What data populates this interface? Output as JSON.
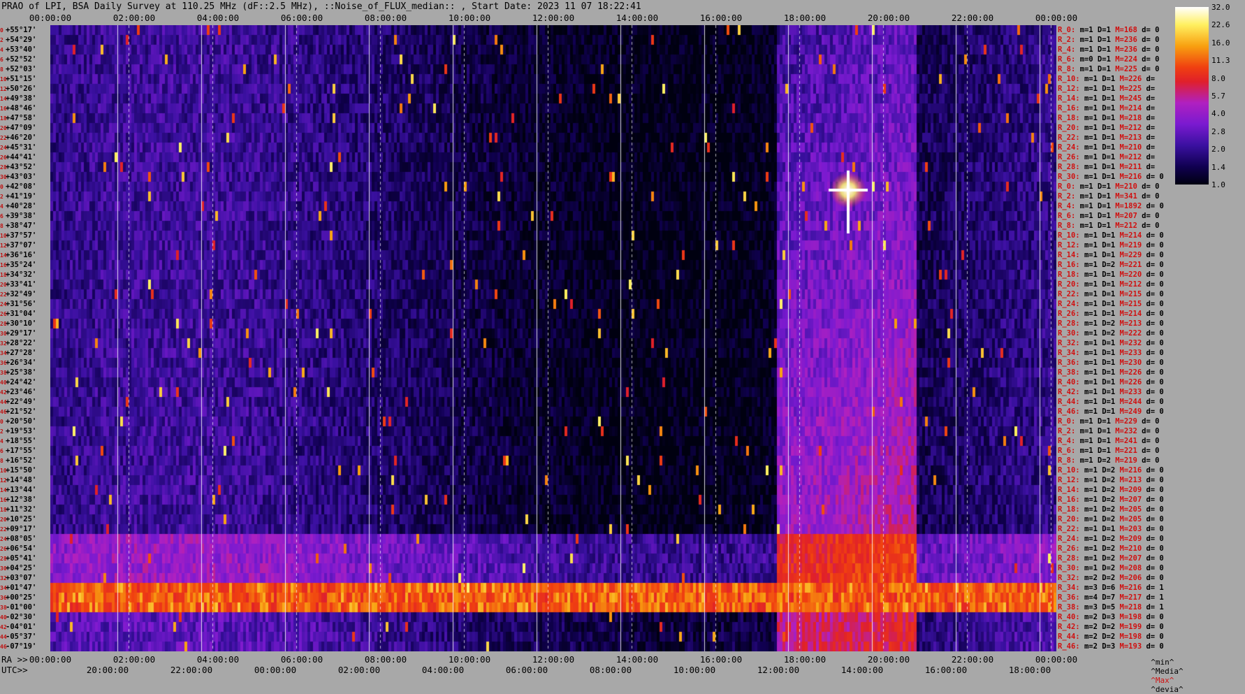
{
  "title": "PRAO of LPI, BSA Daily Survey at 110.25 MHz (dF::2.5 MHz), ::Noise_of_FLUX_median:: , Start Date: 2023 11 07 18:22:41",
  "chart_data": {
    "type": "heatmap",
    "top_axis_ticks": [
      "00:00:00",
      "02:00:00",
      "04:00:00",
      "06:00:00",
      "08:00:00",
      "10:00:00",
      "12:00:00",
      "14:00:00",
      "16:00:00",
      "18:00:00",
      "20:00:00",
      "22:00:00",
      "00:00:00"
    ],
    "bottom_axis_ra_prefix": "RA >>",
    "bottom_axis_ra_ticks": [
      "00:00:00",
      "02:00:00",
      "04:00:00",
      "06:00:00",
      "08:00:00",
      "10:00:00",
      "12:00:00",
      "14:00:00",
      "16:00:00",
      "18:00:00",
      "20:00:00",
      "22:00:00",
      "00:00:00"
    ],
    "bottom_axis_utc_prefix": "UTC>>",
    "bottom_axis_utc_ticks": [
      "20:00:00",
      "22:00:00",
      "00:00:00",
      "02:00:00",
      "04:00:00",
      "06:00:00",
      "08:00:00",
      "10:00:00",
      "12:00:00",
      "14:00:00",
      "16:00:00",
      "18:00:00"
    ],
    "declination_labels": [
      "+55°17'",
      "+54°29'",
      "+53°40'",
      "+52°52'",
      "+52°03'",
      "+51°15'",
      "+50°26'",
      "+49°38'",
      "+48°46'",
      "+47°58'",
      "+47°09'",
      "+46°20'",
      "+45°31'",
      "+44°41'",
      "+43°52'",
      "+43°03'",
      "+42°08'",
      "+41°19'",
      "+40°28'",
      "+39°38'",
      "+38°47'",
      "+37°57'",
      "+37°07'",
      "+36°16'",
      "+35°24'",
      "+34°32'",
      "+33°41'",
      "+32°49'",
      "+31°56'",
      "+31°04'",
      "+30°10'",
      "+29°17'",
      "+28°22'",
      "+27°28'",
      "+26°34'",
      "+25°38'",
      "+24°42'",
      "+23°46'",
      "+22°49'",
      "+21°52'",
      "+20°50'",
      "+19°53'",
      "+18°55'",
      "+17°55'",
      "+16°52'",
      "+15°50'",
      "+14°48'",
      "+13°44'",
      "+12°38'",
      "+11°32'",
      "+10°25'",
      "+09°17'",
      "+08°05'",
      "+06°54'",
      "+05°41'",
      "+04°25'",
      "+03°07'",
      "+01°47'",
      "+00°25'",
      "-01°00'",
      "-02°30'",
      "-04°01'",
      "-05°37'",
      "-07°19'"
    ],
    "declination_row_numbers": [
      "0",
      "2",
      "4",
      "6",
      "8",
      "10",
      "12",
      "14",
      "16",
      "18",
      "20",
      "22",
      "24",
      "26",
      "28",
      "30",
      "0",
      "2",
      "4",
      "6",
      "8",
      "10",
      "12",
      "14",
      "16",
      "18",
      "20",
      "22",
      "24",
      "26",
      "28",
      "30",
      "32",
      "34",
      "36",
      "38",
      "40",
      "42",
      "44",
      "46",
      "0",
      "2",
      "4",
      "6",
      "8",
      "10",
      "12",
      "14",
      "16",
      "18",
      "20",
      "22",
      "24",
      "26",
      "28",
      "30",
      "32",
      "34",
      "36",
      "38",
      "40",
      "42",
      "44",
      "46"
    ],
    "colorbar_ticks": [
      "32.0",
      "22.6",
      "16.0",
      "11.3",
      "8.0",
      "5.7",
      "4.0",
      "2.8",
      "2.0",
      "1.4",
      "1.0"
    ],
    "colorbar_scale": "log",
    "colorbar_range": [
      1.0,
      32.0
    ],
    "colormap": [
      "#000010",
      "#100050",
      "#3a10a0",
      "#7a1ad0",
      "#b020c0",
      "#e0202a",
      "#f04010",
      "#f8a010",
      "#fff060",
      "#ffffff"
    ],
    "receivers": [
      {
        "name": "R_0:",
        "m": "m=1",
        "d": "D=1",
        "max": "M=168",
        "dev": "d= 0"
      },
      {
        "name": "R_2:",
        "m": "m=1",
        "d": "D=1",
        "max": "M=236",
        "dev": "d= 0"
      },
      {
        "name": "R_4:",
        "m": "m=1",
        "d": "D=1",
        "max": "M=236",
        "dev": "d= 0"
      },
      {
        "name": "R_6:",
        "m": "m=0",
        "d": "D=1",
        "max": "M=224",
        "dev": "d= 0"
      },
      {
        "name": "R_8:",
        "m": "m=1",
        "d": "D=1",
        "max": "M=225",
        "dev": "d= 0"
      },
      {
        "name": "R_10:",
        "m": "m=1",
        "d": "D=1",
        "max": "M=226",
        "dev": "d="
      },
      {
        "name": "R_12:",
        "m": "m=1",
        "d": "D=1",
        "max": "M=225",
        "dev": "d="
      },
      {
        "name": "R_14:",
        "m": "m=1",
        "d": "D=1",
        "max": "M=245",
        "dev": "d="
      },
      {
        "name": "R_16:",
        "m": "m=1",
        "d": "D=1",
        "max": "M=214",
        "dev": "d="
      },
      {
        "name": "R_18:",
        "m": "m=1",
        "d": "D=1",
        "max": "M=218",
        "dev": "d="
      },
      {
        "name": "R_20:",
        "m": "m=1",
        "d": "D=1",
        "max": "M=212",
        "dev": "d="
      },
      {
        "name": "R_22:",
        "m": "m=1",
        "d": "D=1",
        "max": "M=213",
        "dev": "d="
      },
      {
        "name": "R_24:",
        "m": "m=1",
        "d": "D=1",
        "max": "M=210",
        "dev": "d="
      },
      {
        "name": "R_26:",
        "m": "m=1",
        "d": "D=1",
        "max": "M=212",
        "dev": "d="
      },
      {
        "name": "R_28:",
        "m": "m=1",
        "d": "D=1",
        "max": "M=211",
        "dev": "d="
      },
      {
        "name": "R_30:",
        "m": "m=1",
        "d": "D=1",
        "max": "M=216",
        "dev": "d= 0"
      },
      {
        "name": "R_0:",
        "m": "m=1",
        "d": "D=1",
        "max": "M=210",
        "dev": "d= 0"
      },
      {
        "name": "R_2:",
        "m": "m=1",
        "d": "D=1",
        "max": "M=341",
        "dev": "d= 0"
      },
      {
        "name": "R_4:",
        "m": "m=1",
        "d": "D=1",
        "max": "M=1892",
        "dev": "d= 0"
      },
      {
        "name": "R_6:",
        "m": "m=1",
        "d": "D=1",
        "max": "M=207",
        "dev": "d= 0"
      },
      {
        "name": "R_8:",
        "m": "m=1",
        "d": "D=1",
        "max": "M=212",
        "dev": "d= 0"
      },
      {
        "name": "R_10:",
        "m": "m=1",
        "d": "D=1",
        "max": "M=214",
        "dev": "d= 0"
      },
      {
        "name": "R_12:",
        "m": "m=1",
        "d": "D=1",
        "max": "M=219",
        "dev": "d= 0"
      },
      {
        "name": "R_14:",
        "m": "m=1",
        "d": "D=1",
        "max": "M=229",
        "dev": "d= 0"
      },
      {
        "name": "R_16:",
        "m": "m=1",
        "d": "D=2",
        "max": "M=221",
        "dev": "d= 0"
      },
      {
        "name": "R_18:",
        "m": "m=1",
        "d": "D=1",
        "max": "M=220",
        "dev": "d= 0"
      },
      {
        "name": "R_20:",
        "m": "m=1",
        "d": "D=1",
        "max": "M=212",
        "dev": "d= 0"
      },
      {
        "name": "R_22:",
        "m": "m=1",
        "d": "D=1",
        "max": "M=215",
        "dev": "d= 0"
      },
      {
        "name": "R_24:",
        "m": "m=1",
        "d": "D=1",
        "max": "M=215",
        "dev": "d= 0"
      },
      {
        "name": "R_26:",
        "m": "m=1",
        "d": "D=1",
        "max": "M=214",
        "dev": "d= 0"
      },
      {
        "name": "R_28:",
        "m": "m=1",
        "d": "D=2",
        "max": "M=213",
        "dev": "d= 0"
      },
      {
        "name": "R_30:",
        "m": "m=1",
        "d": "D=2",
        "max": "M=222",
        "dev": "d= 0"
      },
      {
        "name": "R_32:",
        "m": "m=1",
        "d": "D=1",
        "max": "M=232",
        "dev": "d= 0"
      },
      {
        "name": "R_34:",
        "m": "m=1",
        "d": "D=1",
        "max": "M=233",
        "dev": "d= 0"
      },
      {
        "name": "R_36:",
        "m": "m=1",
        "d": "D=1",
        "max": "M=230",
        "dev": "d= 0"
      },
      {
        "name": "R_38:",
        "m": "m=1",
        "d": "D=1",
        "max": "M=226",
        "dev": "d= 0"
      },
      {
        "name": "R_40:",
        "m": "m=1",
        "d": "D=1",
        "max": "M=226",
        "dev": "d= 0"
      },
      {
        "name": "R_42:",
        "m": "m=1",
        "d": "D=1",
        "max": "M=233",
        "dev": "d= 0"
      },
      {
        "name": "R_44:",
        "m": "m=1",
        "d": "D=1",
        "max": "M=244",
        "dev": "d= 0"
      },
      {
        "name": "R_46:",
        "m": "m=1",
        "d": "D=1",
        "max": "M=249",
        "dev": "d= 0"
      },
      {
        "name": "R_0:",
        "m": "m=1",
        "d": "D=1",
        "max": "M=229",
        "dev": "d= 0"
      },
      {
        "name": "R_2:",
        "m": "m=1",
        "d": "D=1",
        "max": "M=232",
        "dev": "d= 0"
      },
      {
        "name": "R_4:",
        "m": "m=1",
        "d": "D=1",
        "max": "M=241",
        "dev": "d= 0"
      },
      {
        "name": "R_6:",
        "m": "m=1",
        "d": "D=1",
        "max": "M=221",
        "dev": "d= 0"
      },
      {
        "name": "R_8:",
        "m": "m=1",
        "d": "D=2",
        "max": "M=219",
        "dev": "d= 0"
      },
      {
        "name": "R_10:",
        "m": "m=1",
        "d": "D=2",
        "max": "M=216",
        "dev": "d= 0"
      },
      {
        "name": "R_12:",
        "m": "m=1",
        "d": "D=2",
        "max": "M=213",
        "dev": "d= 0"
      },
      {
        "name": "R_14:",
        "m": "m=1",
        "d": "D=2",
        "max": "M=209",
        "dev": "d= 0"
      },
      {
        "name": "R_16:",
        "m": "m=1",
        "d": "D=2",
        "max": "M=207",
        "dev": "d= 0"
      },
      {
        "name": "R_18:",
        "m": "m=1",
        "d": "D=2",
        "max": "M=205",
        "dev": "d= 0"
      },
      {
        "name": "R_20:",
        "m": "m=1",
        "d": "D=2",
        "max": "M=205",
        "dev": "d= 0"
      },
      {
        "name": "R_22:",
        "m": "m=1",
        "d": "D=1",
        "max": "M=203",
        "dev": "d= 0"
      },
      {
        "name": "R_24:",
        "m": "m=1",
        "d": "D=2",
        "max": "M=209",
        "dev": "d= 0"
      },
      {
        "name": "R_26:",
        "m": "m=1",
        "d": "D=2",
        "max": "M=210",
        "dev": "d= 0"
      },
      {
        "name": "R_28:",
        "m": "m=1",
        "d": "D=2",
        "max": "M=207",
        "dev": "d= 0"
      },
      {
        "name": "R_30:",
        "m": "m=1",
        "d": "D=2",
        "max": "M=208",
        "dev": "d= 0"
      },
      {
        "name": "R_32:",
        "m": "m=2",
        "d": "D=2",
        "max": "M=206",
        "dev": "d= 0"
      },
      {
        "name": "R_34:",
        "m": "m=3",
        "d": "D=6",
        "max": "M=216",
        "dev": "d= 1"
      },
      {
        "name": "R_36:",
        "m": "m=4",
        "d": "D=7",
        "max": "M=217",
        "dev": "d= 1"
      },
      {
        "name": "R_38:",
        "m": "m=3",
        "d": "D=5",
        "max": "M=218",
        "dev": "d= 1"
      },
      {
        "name": "R_40:",
        "m": "m=2",
        "d": "D=3",
        "max": "M=198",
        "dev": "d= 0"
      },
      {
        "name": "R_42:",
        "m": "m=2",
        "d": "D=2",
        "max": "M=199",
        "dev": "d= 0"
      },
      {
        "name": "R_44:",
        "m": "m=2",
        "d": "D=2",
        "max": "M=198",
        "dev": "d= 0"
      },
      {
        "name": "R_46:",
        "m": "m=2",
        "d": "D=3",
        "max": "M=193",
        "dev": "d= 0"
      }
    ],
    "legend": {
      "min": "^min^",
      "median": "^Media^",
      "max": "^Max^",
      "dev": "^devia^"
    }
  }
}
